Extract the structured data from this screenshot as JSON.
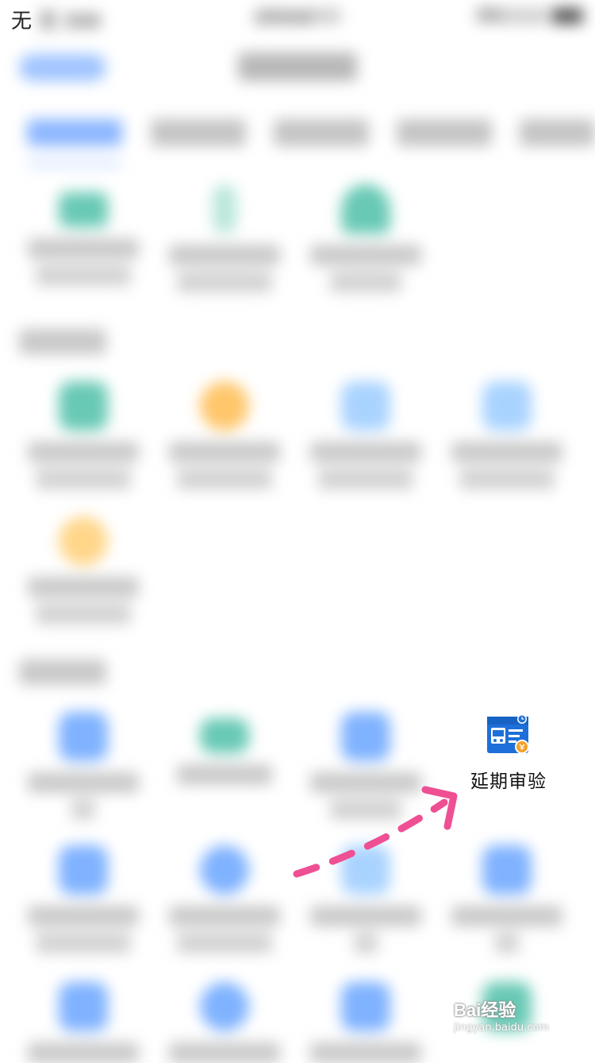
{
  "status_bar": {
    "carrier": "无 SIM",
    "time": "上午10:46",
    "battery": "75%"
  },
  "nav": {
    "back_label": "",
    "title": ""
  },
  "highlight": {
    "label": "延期审验",
    "icon": "vehicle-license-clock-icon",
    "accent": "#1e6fd9"
  },
  "annotation": {
    "arrow_color": "#ef4f93"
  },
  "watermark": {
    "main": "Bai经验",
    "sub": "jingyan.baidu.com"
  }
}
